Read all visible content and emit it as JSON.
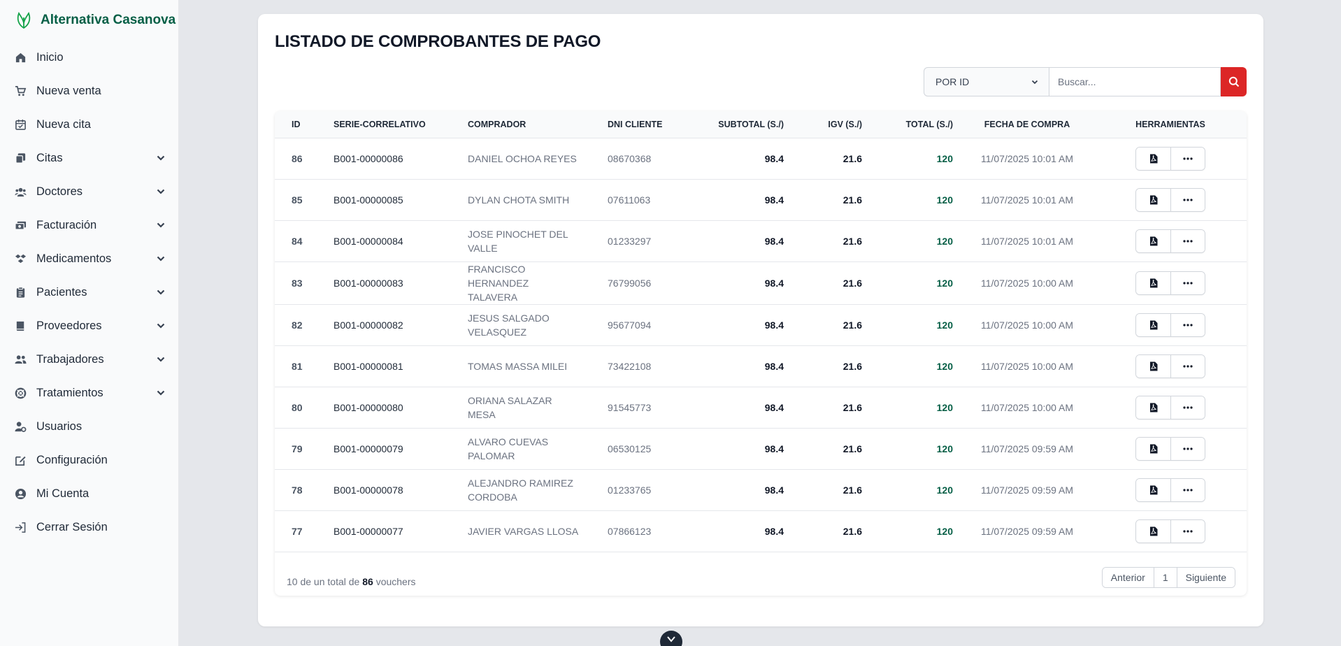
{
  "app": {
    "name": "Alternativa Casanova"
  },
  "sidebar": {
    "items": [
      {
        "label": "Inicio",
        "icon": "home-icon",
        "expandable": false
      },
      {
        "label": "Nueva venta",
        "icon": "cart-icon",
        "expandable": false
      },
      {
        "label": "Nueva cita",
        "icon": "calendar-icon",
        "expandable": false
      },
      {
        "label": "Citas",
        "icon": "copy-icon",
        "expandable": true
      },
      {
        "label": "Doctores",
        "icon": "users-icon",
        "expandable": true
      },
      {
        "label": "Facturación",
        "icon": "money-icon",
        "expandable": true
      },
      {
        "label": "Medicamentos",
        "icon": "pills-icon",
        "expandable": true
      },
      {
        "label": "Pacientes",
        "icon": "clipboard-icon",
        "expandable": true
      },
      {
        "label": "Proveedores",
        "icon": "book-icon",
        "expandable": true
      },
      {
        "label": "Trabajadores",
        "icon": "workers-icon",
        "expandable": true
      },
      {
        "label": "Tratamientos",
        "icon": "lifebuoy-icon",
        "expandable": true
      },
      {
        "label": "Usuarios",
        "icon": "user-gear-icon",
        "expandable": false
      },
      {
        "label": "Configuración",
        "icon": "edit-icon",
        "expandable": false
      },
      {
        "label": "Mi Cuenta",
        "icon": "user-circle-icon",
        "expandable": false
      },
      {
        "label": "Cerrar Sesión",
        "icon": "logout-icon",
        "expandable": false
      }
    ]
  },
  "main": {
    "title": "LISTADO DE COMPROBANTES DE PAGO",
    "search": {
      "filter_value": "POR ID",
      "placeholder": "Buscar..."
    },
    "table": {
      "headers": {
        "id": "ID",
        "serie": "SERIE-CORRELATIVO",
        "comprador": "COMPRADOR",
        "dni": "DNI CLIENTE",
        "subtotal": "SUBTOTAL (S./)",
        "igv": "IGV (S./)",
        "total": "TOTAL (S./)",
        "fecha": "FECHA DE COMPRA",
        "herramientas": "HERRAMIENTAS"
      },
      "rows": [
        {
          "id": "86",
          "serie": "B001-00000086",
          "comprador": "DANIEL OCHOA REYES",
          "dni": "08670368",
          "subtotal": "98.4",
          "igv": "21.6",
          "total": "120",
          "fecha": "11/07/2025 10:01 AM"
        },
        {
          "id": "85",
          "serie": "B001-00000085",
          "comprador": "DYLAN CHOTA SMITH",
          "dni": "07611063",
          "subtotal": "98.4",
          "igv": "21.6",
          "total": "120",
          "fecha": "11/07/2025 10:01 AM"
        },
        {
          "id": "84",
          "serie": "B001-00000084",
          "comprador": "JOSE PINOCHET DEL VALLE",
          "dni": "01233297",
          "subtotal": "98.4",
          "igv": "21.6",
          "total": "120",
          "fecha": "11/07/2025 10:01 AM"
        },
        {
          "id": "83",
          "serie": "B001-00000083",
          "comprador": "FRANCISCO HERNANDEZ TALAVERA",
          "dni": "76799056",
          "subtotal": "98.4",
          "igv": "21.6",
          "total": "120",
          "fecha": "11/07/2025 10:00 AM"
        },
        {
          "id": "82",
          "serie": "B001-00000082",
          "comprador": "JESUS SALGADO VELASQUEZ",
          "dni": "95677094",
          "subtotal": "98.4",
          "igv": "21.6",
          "total": "120",
          "fecha": "11/07/2025 10:00 AM"
        },
        {
          "id": "81",
          "serie": "B001-00000081",
          "comprador": "TOMAS MASSA MILEI",
          "dni": "73422108",
          "subtotal": "98.4",
          "igv": "21.6",
          "total": "120",
          "fecha": "11/07/2025 10:00 AM"
        },
        {
          "id": "80",
          "serie": "B001-00000080",
          "comprador": "ORIANA SALAZAR MESA",
          "dni": "91545773",
          "subtotal": "98.4",
          "igv": "21.6",
          "total": "120",
          "fecha": "11/07/2025 10:00 AM"
        },
        {
          "id": "79",
          "serie": "B001-00000079",
          "comprador": "ALVARO CUEVAS PALOMAR",
          "dni": "06530125",
          "subtotal": "98.4",
          "igv": "21.6",
          "total": "120",
          "fecha": "11/07/2025 09:59 AM"
        },
        {
          "id": "78",
          "serie": "B001-00000078",
          "comprador": "ALEJANDRO RAMIREZ CORDOBA",
          "dni": "01233765",
          "subtotal": "98.4",
          "igv": "21.6",
          "total": "120",
          "fecha": "11/07/2025 09:59 AM"
        },
        {
          "id": "77",
          "serie": "B001-00000077",
          "comprador": "JAVIER VARGAS LLOSA",
          "dni": "07866123",
          "subtotal": "98.4",
          "igv": "21.6",
          "total": "120",
          "fecha": "11/07/2025 09:59 AM"
        }
      ]
    },
    "summary": {
      "shown": "10",
      "mid_text": "de un total de",
      "total": "86",
      "unit": "vouchers"
    },
    "pagination": {
      "prev": "Anterior",
      "current": "1",
      "next": "Siguiente"
    }
  },
  "colors": {
    "brand": "#065f46",
    "danger": "#dc2626",
    "total_text": "#065f46"
  }
}
